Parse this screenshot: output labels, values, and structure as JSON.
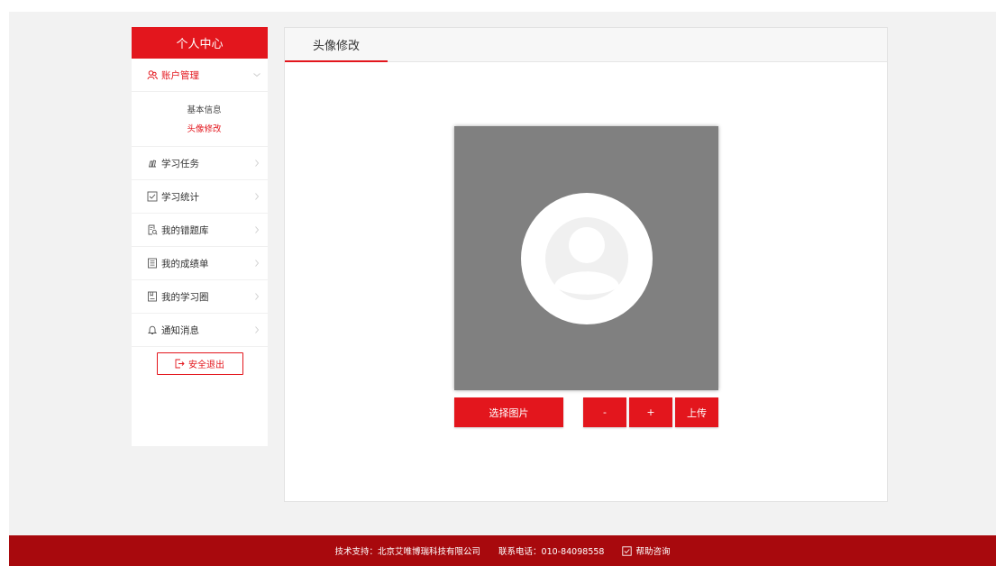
{
  "sidebar": {
    "title": "个人中心",
    "account": {
      "label": "账户管理",
      "icon": "users-icon"
    },
    "submenu": [
      {
        "label": "基本信息",
        "active": false
      },
      {
        "label": "头像修改",
        "active": true
      }
    ],
    "items": [
      {
        "label": "学习任务",
        "icon": "books-icon"
      },
      {
        "label": "学习统计",
        "icon": "checkbox-icon"
      },
      {
        "label": "我的错题库",
        "icon": "document-search-icon"
      },
      {
        "label": "我的成绩单",
        "icon": "list-document-icon"
      },
      {
        "label": "我的学习圈",
        "icon": "notebook-icon"
      },
      {
        "label": "通知消息",
        "icon": "bell-icon"
      }
    ],
    "logout_label": "安全退出"
  },
  "main": {
    "tab_label": "头像修改",
    "buttons": {
      "select": "选择图片",
      "minus": "-",
      "plus": "+",
      "upload": "上传"
    }
  },
  "footer": {
    "support": "技术支持：北京艾唯博瑞科技有限公司",
    "phone": "联系电话：010-84098558",
    "help": "帮助咨询"
  },
  "colors": {
    "accent": "#e3161d",
    "footer_bg": "#a8090d",
    "cropper_bg": "#808080"
  }
}
